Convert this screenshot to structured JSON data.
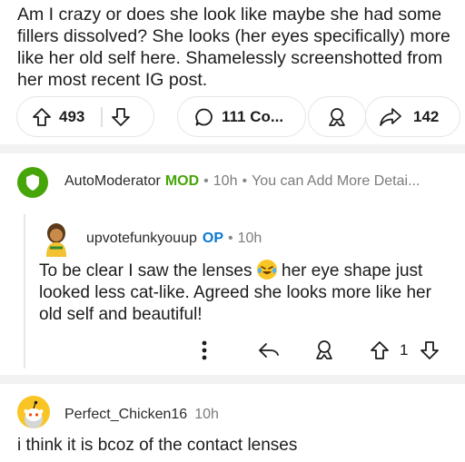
{
  "post": {
    "text": "Am I crazy or does she look like maybe she had some fillers dissolved? She looks (her eyes specifically) more like her old self here. Shamelessly screenshotted from her most recent IG post."
  },
  "actions": {
    "upvotes": "493",
    "comments": "111 Co...",
    "shares": "142"
  },
  "comments": [
    {
      "username": "AutoModerator",
      "tag": "MOD",
      "time": "10h",
      "preview": "You can Add More Detai..."
    },
    {
      "username": "upvotefunkyouup",
      "tag": "OP",
      "time": "10h",
      "body_part1": "To be clear I saw the lenses",
      "body_part2": "her eye shape just looked less cat-like. Agreed she looks more like her old self and beautiful!",
      "votes": "1"
    },
    {
      "username": "Perfect_Chicken16",
      "time": "10h",
      "body": "i think it is bcoz of the contact lenses"
    }
  ],
  "colors": {
    "mod_green": "#46a508",
    "op_blue": "#0a78d3",
    "divider": "#f2f2f2",
    "snoo_orange": "#ff4500",
    "avatar_yellow": "#f9c525"
  },
  "icons": [
    "upvote-icon",
    "downvote-icon",
    "comment-icon",
    "award-icon",
    "share-icon",
    "shield-icon",
    "more-icon",
    "reply-icon",
    "snoo-icon",
    "emoji-rofl"
  ]
}
